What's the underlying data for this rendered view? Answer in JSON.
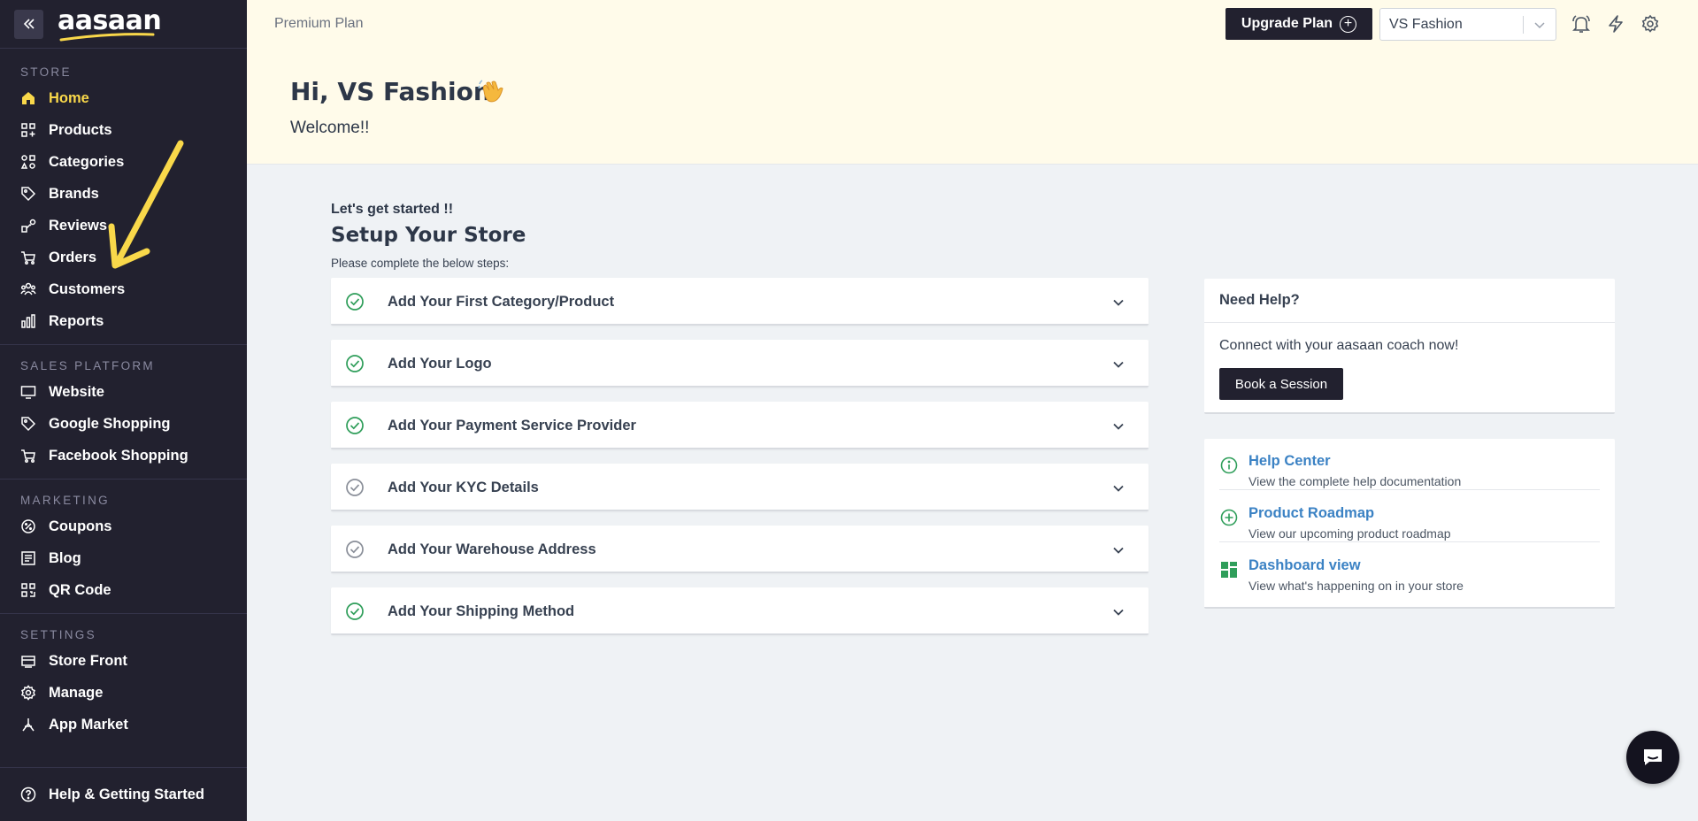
{
  "sidebar": {
    "logo": "aasaan",
    "sections": [
      {
        "title": "STORE",
        "items": [
          {
            "label": "Home",
            "icon": "home-icon",
            "active": true
          },
          {
            "label": "Products",
            "icon": "products-icon"
          },
          {
            "label": "Categories",
            "icon": "categories-icon"
          },
          {
            "label": "Brands",
            "icon": "tag-icon"
          },
          {
            "label": "Reviews",
            "icon": "reviews-icon"
          },
          {
            "label": "Orders",
            "icon": "cart-icon"
          },
          {
            "label": "Customers",
            "icon": "users-icon"
          },
          {
            "label": "Reports",
            "icon": "bar-chart-icon"
          }
        ]
      },
      {
        "title": "SALES PLATFORM",
        "items": [
          {
            "label": "Website",
            "icon": "monitor-icon"
          },
          {
            "label": "Google Shopping",
            "icon": "tag-icon"
          },
          {
            "label": "Facebook Shopping",
            "icon": "cart-icon"
          }
        ]
      },
      {
        "title": "MARKETING",
        "items": [
          {
            "label": "Coupons",
            "icon": "coupon-icon"
          },
          {
            "label": "Blog",
            "icon": "blog-icon"
          },
          {
            "label": "QR Code",
            "icon": "qr-icon"
          }
        ]
      },
      {
        "title": "SETTINGS",
        "items": [
          {
            "label": "Store Front",
            "icon": "storefront-icon"
          },
          {
            "label": "Manage",
            "icon": "gear-icon"
          },
          {
            "label": "App Market",
            "icon": "app-market-icon"
          }
        ]
      }
    ],
    "help_label": "Help & Getting Started"
  },
  "topbar": {
    "plan": "Premium Plan",
    "upgrade_label": "Upgrade Plan",
    "store_name": "VS Fashion"
  },
  "welcome": {
    "greeting": "Hi, VS Fashion",
    "subtitle": "Welcome!!"
  },
  "setup": {
    "kicker": "Let's get started !!",
    "title": "Setup Your Store",
    "instruction": "Please complete the below steps:",
    "steps": [
      {
        "label": "Add Your First Category/Product",
        "done": true
      },
      {
        "label": "Add Your Logo",
        "done": true
      },
      {
        "label": "Add Your Payment Service Provider",
        "done": true
      },
      {
        "label": "Add Your KYC Details",
        "done": false
      },
      {
        "label": "Add Your Warehouse Address",
        "done": false
      },
      {
        "label": "Add Your Shipping Method",
        "done": true
      }
    ]
  },
  "help": {
    "title": "Need Help?",
    "text": "Connect with your aasaan coach now!",
    "button": "Book a Session"
  },
  "links": [
    {
      "title": "Help Center",
      "desc": "View the complete help documentation",
      "icon": "info-icon"
    },
    {
      "title": "Product Roadmap",
      "desc": "View our upcoming product roadmap",
      "icon": "plus-circle-icon"
    },
    {
      "title": "Dashboard view",
      "desc": "View what's happening on in your store",
      "icon": "grid-icon"
    }
  ],
  "colors": {
    "sidebar_bg": "#22212f",
    "active": "#f9d84a",
    "done_check": "#2f9e5a",
    "pending_check": "#8a8f99",
    "link": "#3b82c4",
    "header_bg": "#fffbea"
  }
}
